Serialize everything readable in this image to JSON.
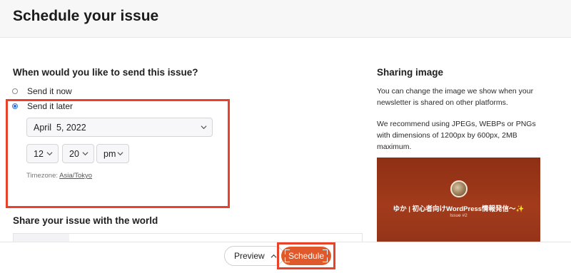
{
  "header": {
    "title": "Schedule your issue"
  },
  "send_options": {
    "heading": "When would you like to send this issue?",
    "options": [
      {
        "label": "Send it now",
        "selected": false
      },
      {
        "label": "Send it later",
        "selected": true
      }
    ],
    "date": "April  5, 2022",
    "hour": "12",
    "minute": "20",
    "period": "pm",
    "timezone_label": "Timezone: ",
    "timezone_value": "Asia/Tokyo"
  },
  "share": {
    "heading": "Share your issue with the world"
  },
  "sharing_image": {
    "heading": "Sharing image",
    "text1": "You can change the image we show when your newsletter is shared on other platforms.",
    "text2": "We recommend using JPEGs, WEBPs or PNGs with dimensions of 1200px by 600px, 2MB maximum.",
    "image_title": "ゆか | 初心者向けWordPress情報発信〜✨",
    "image_subtitle": "Issue #2"
  },
  "footer": {
    "preview_label": "Preview",
    "schedule_label": "Schedule"
  },
  "colors": {
    "accent": "#e0592a",
    "highlight": "#e8432a",
    "radio": "#2f6fe0"
  }
}
